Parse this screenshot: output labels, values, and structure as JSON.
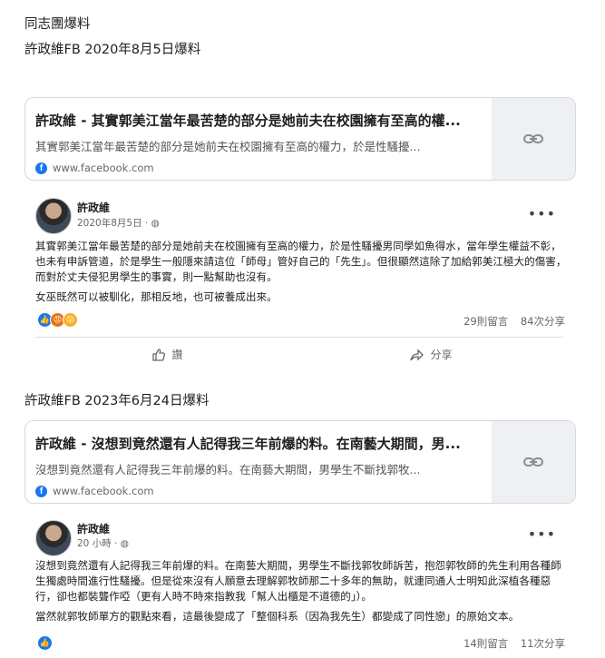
{
  "headings": {
    "title": "同志團爆料",
    "h1": "許政維FB 2020年8月5日爆料",
    "h2": "許政維FB 2023年6月24日爆料"
  },
  "cards": [
    {
      "title": "許政維 - 其實郭美江當年最苦楚的部分是她前夫在校園擁有至高的權...",
      "desc": "其實郭美江當年最苦楚的部分是她前夫在校園擁有至高的權力，於是性騷擾...",
      "domain": "www.facebook.com",
      "icon": "link-icon"
    },
    {
      "title": "許政維 - 沒想到竟然還有人記得我三年前爆的料。在南藝大期間，男...",
      "desc": "沒想到竟然還有人記得我三年前爆的料。在南藝大期間，男學生不斷找郭牧...",
      "domain": "www.facebook.com",
      "icon": "link-icon"
    }
  ],
  "posts": [
    {
      "author": "許政維",
      "time": "2020年8月5日",
      "body": [
        "其實郭美江當年最苦楚的部分是她前夫在校園擁有至高的權力，於是性騷擾男同學如魚得水，當年學生權益不彰，也未有申訴管道，於是學生一般隱來請這位「師母」管好自己的「先生」。但很顯然這除了加給郭美江極大的傷害，而對於丈夫侵犯男學生的事實，則一點幫助也沒有。",
        "女巫既然可以被馴化，那相反地，也可被養成出來。"
      ],
      "comments": "29則留言",
      "shares": "84次分享",
      "like_label": "讚",
      "share_label": "分享"
    },
    {
      "author": "許政維",
      "time": "20 小時",
      "body": [
        "沒想到竟然還有人記得我三年前爆的料。在南藝大期間，男學生不斷找郭牧師訴苦，抱怨郭牧師的先生利用各種師生獨處時間進行性騷擾。但是從來沒有人願意去理解郭牧師那二十多年的無助，就連同通人士明知此深植各種惡行，卻也都裝聾作啞（更有人時不時來指教我「幫人出櫃是不道德的」）。",
        "當然就郭牧師單方的觀點來看，這最後變成了「整個科系（因為我先生）都變成了同性戀」的原始文本。"
      ],
      "comments": "14則留言",
      "shares": "11次分享"
    }
  ],
  "colors": {
    "like": "#1877f2",
    "angry": "#e9710f",
    "wow": "#f7b125"
  }
}
